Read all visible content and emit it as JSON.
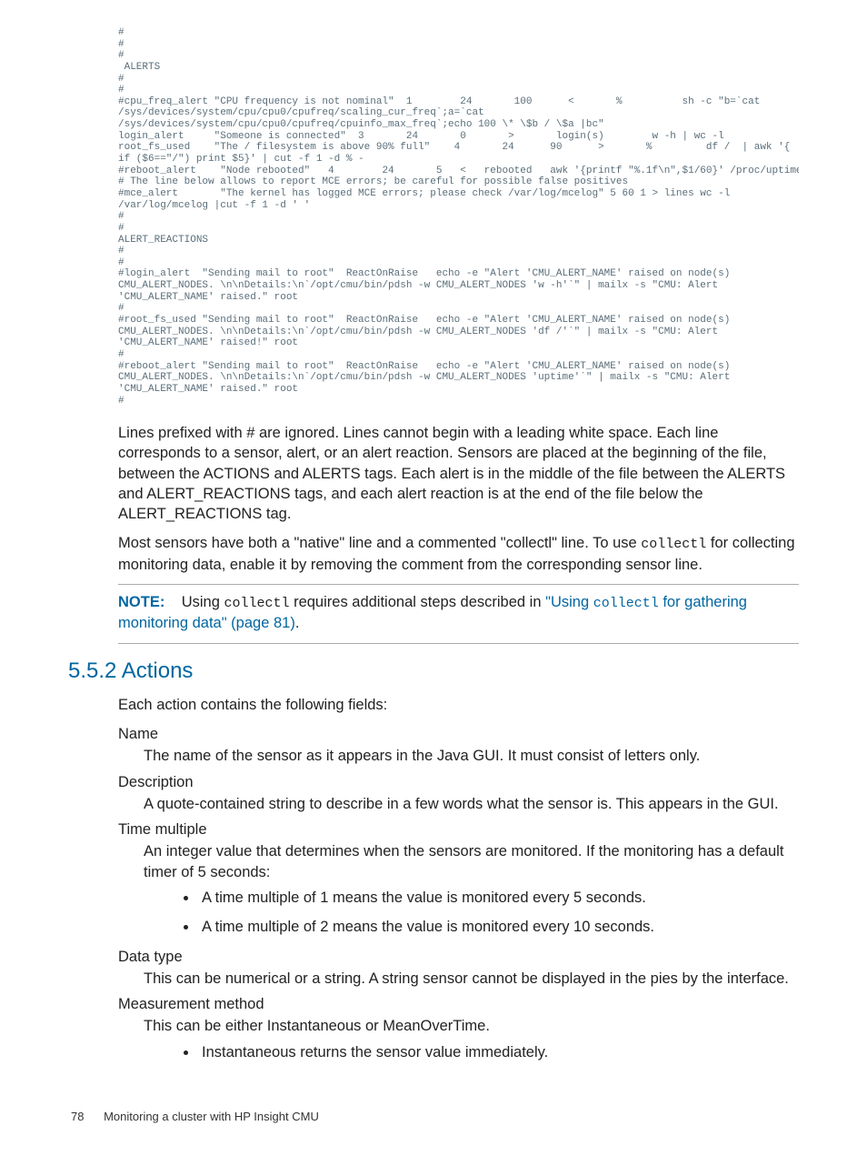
{
  "code_block": "#\n#\n#\n ALERTS\n#\n#\n#cpu_freq_alert \"CPU frequency is not nominal\"  1        24       100      <       %          sh -c \"b=`cat\n/sys/devices/system/cpu/cpu0/cpufreq/scaling_cur_freq`;a=`cat\n/sys/devices/system/cpu/cpu0/cpufreq/cpuinfo_max_freq`;echo 100 \\* \\$b / \\$a |bc\"\nlogin_alert     \"Someone is connected\"  3       24       0       >       login(s)        w -h | wc -l\nroot_fs_used    \"The / filesystem is above 90% full\"    4       24      90      >       %         df /  | awk '{\nif ($6==\"/\") print $5}' | cut -f 1 -d % -\n#reboot_alert    \"Node rebooted\"   4        24       5   <   rebooted   awk '{printf \"%.1f\\n\",$1/60}' /proc/uptime\n# The line below allows to report MCE errors; be careful for possible false positives\n#mce_alert       \"The kernel has logged MCE errors; please check /var/log/mcelog\" 5 60 1 > lines wc -l\n/var/log/mcelog |cut -f 1 -d ' '\n#\n#\nALERT_REACTIONS\n#\n#\n#login_alert  \"Sending mail to root\"  ReactOnRaise   echo -e \"Alert 'CMU_ALERT_NAME' raised on node(s)\nCMU_ALERT_NODES. \\n\\nDetails:\\n`/opt/cmu/bin/pdsh -w CMU_ALERT_NODES 'w -h'`\" | mailx -s \"CMU: Alert\n'CMU_ALERT_NAME' raised.\" root\n#\n#root_fs_used \"Sending mail to root\"  ReactOnRaise   echo -e \"Alert 'CMU_ALERT_NAME' raised on node(s)\nCMU_ALERT_NODES. \\n\\nDetails:\\n`/opt/cmu/bin/pdsh -w CMU_ALERT_NODES 'df /'`\" | mailx -s \"CMU: Alert\n'CMU_ALERT_NAME' raised!\" root\n#\n#reboot_alert \"Sending mail to root\"  ReactOnRaise   echo -e \"Alert 'CMU_ALERT_NAME' raised on node(s)\nCMU_ALERT_NODES. \\n\\nDetails:\\n`/opt/cmu/bin/pdsh -w CMU_ALERT_NODES 'uptime'`\" | mailx -s \"CMU: Alert\n'CMU_ALERT_NAME' raised.\" root\n#",
  "para1": "Lines prefixed with # are ignored. Lines cannot begin with a leading white space. Each line corresponds to a sensor, alert, or an alert reaction. Sensors are placed at the beginning of the file, between the ACTIONS and ALERTS tags. Each alert is in the middle of the file between the ALERTS and ALERT_REACTIONS tags, and each alert reaction is at the end of the file below the ALERT_REACTIONS tag.",
  "para2_pre": "Most sensors have both a \"native\" line and a commented \"collectl\" line. To use ",
  "para2_code": "collectl",
  "para2_post": " for collecting monitoring data, enable it by removing the comment from the corresponding sensor line.",
  "note": {
    "label": "NOTE:",
    "pre": "Using ",
    "code": "collectl",
    "mid": " requires additional steps described in ",
    "link_pre": "\"Using ",
    "link_code": "collectl",
    "link_post": " for gathering monitoring data\" (page 81)",
    "end": "."
  },
  "section_heading": "5.5.2 Actions",
  "intro": "Each action contains the following fields:",
  "fields": {
    "name": {
      "term": "Name",
      "desc": "The name of the sensor as it appears in the Java GUI. It must consist of letters only."
    },
    "description": {
      "term": "Description",
      "desc": "A quote-contained string to describe in a few words what the sensor is. This appears in the GUI."
    },
    "time_multiple": {
      "term": "Time multiple",
      "desc": "An integer value that determines when the sensors are monitored. If the monitoring has a default timer of 5 seconds:",
      "bullet1": "A time multiple of 1 means the value is monitored every 5 seconds.",
      "bullet2": "A time multiple of 2 means the value is monitored every 10 seconds."
    },
    "data_type": {
      "term": "Data type",
      "desc": "This can be numerical or a string. A string sensor cannot be displayed in the pies by the interface."
    },
    "measurement": {
      "term": "Measurement method",
      "desc": "This can be either Instantaneous or MeanOverTime.",
      "bullet1": "Instantaneous returns the sensor value immediately."
    }
  },
  "footer": {
    "page": "78",
    "title": "Monitoring a cluster with HP Insight CMU"
  }
}
